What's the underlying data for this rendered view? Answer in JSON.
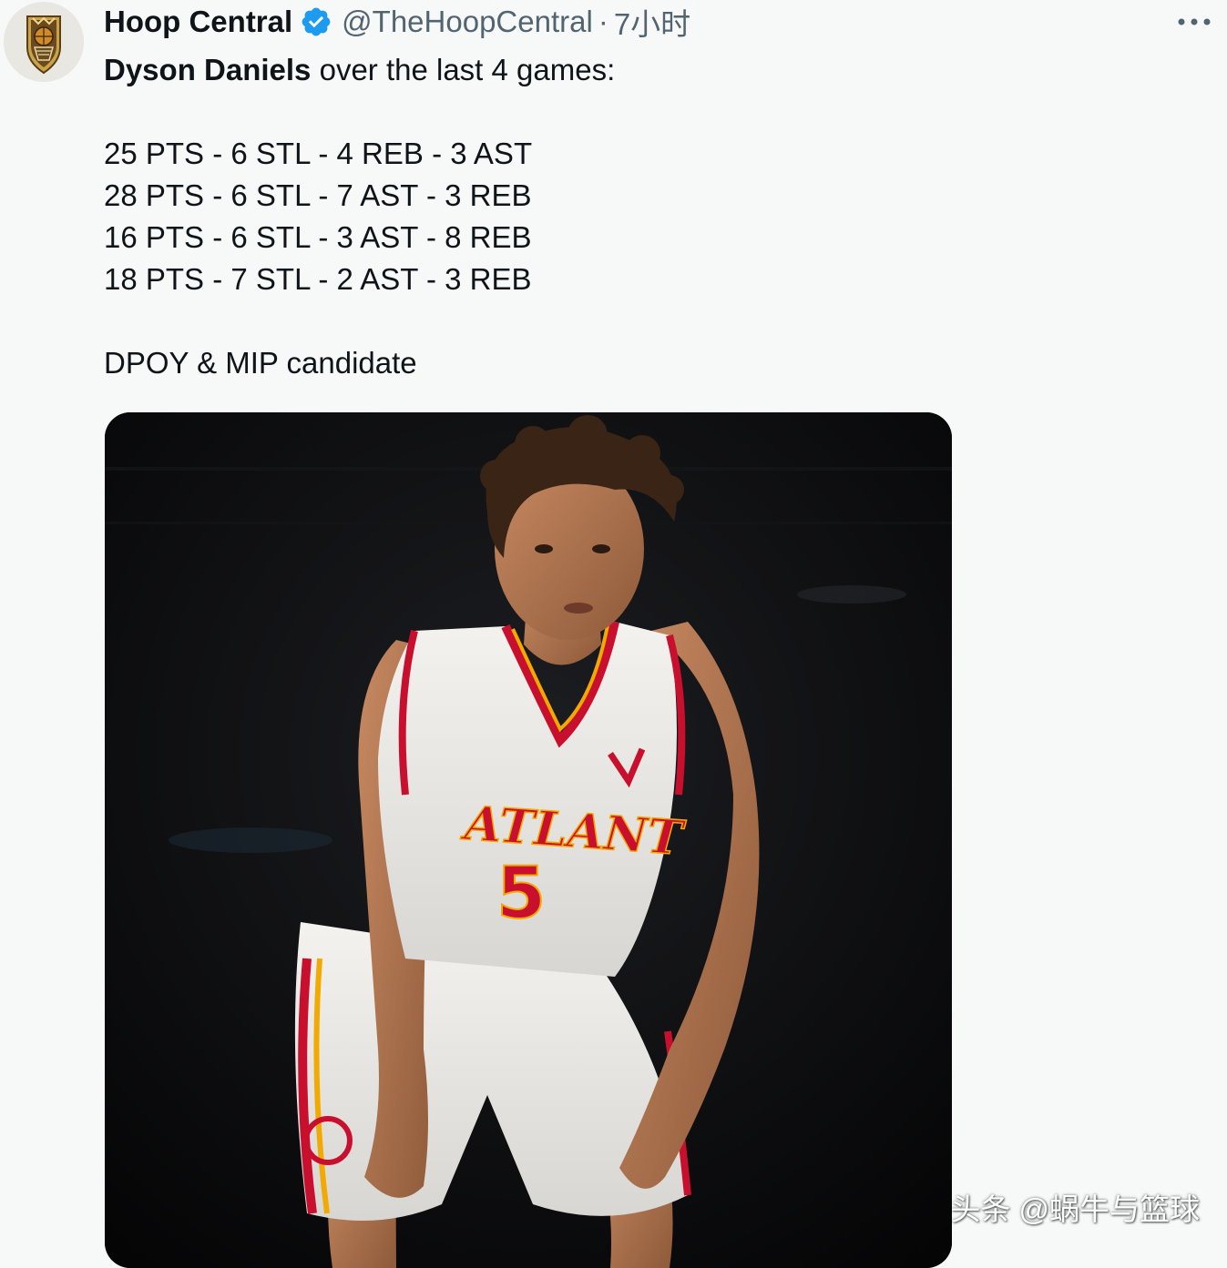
{
  "post": {
    "author_name": "Hoop Central",
    "handle": "@TheHoopCentral",
    "separator": "·",
    "time": "7小时",
    "text": {
      "player_name": "Dyson Daniels",
      "intro_rest": " over the last 4 games:",
      "stat_lines": [
        "25 PTS - 6 STL - 4 REB - 3 AST",
        "28 PTS - 6 STL - 7 AST - 3 REB",
        "16 PTS - 6 STL - 3 AST - 8 REB",
        "18 PTS - 7 STL - 2 AST - 3 REB"
      ],
      "closing": "DPOY & MIP candidate"
    },
    "photo": {
      "jersey_team": "ATLANT",
      "jersey_number": "5"
    }
  },
  "watermark": "头条 @蜗牛与篮球",
  "icons": {
    "avatar": "hoop-central-logo-icon",
    "verified": "verified-badge-icon",
    "more": "more-options-icon"
  },
  "colors": {
    "background": "#f7f9f9",
    "text_primary": "#0f1419",
    "text_secondary": "#536471",
    "verified_blue": "#1d9bf0",
    "jersey_red": "#c8102e",
    "jersey_gold": "#f2a900"
  }
}
